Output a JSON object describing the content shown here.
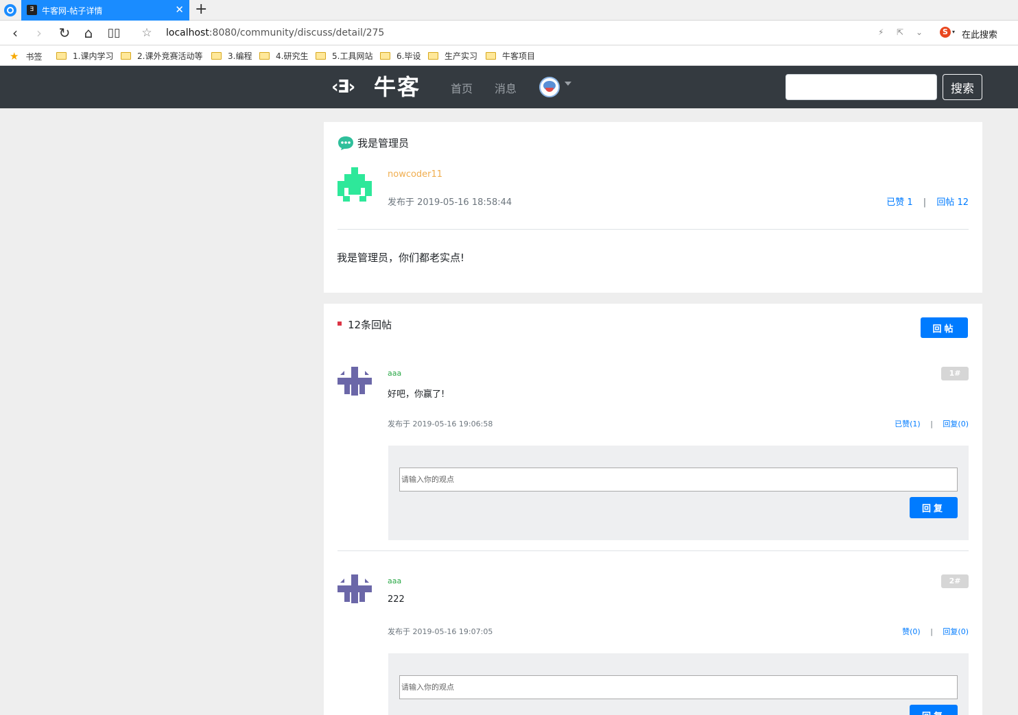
{
  "browser": {
    "tab_title": "牛客网-帖子详情",
    "tab_favicon": "Ǝ",
    "url_host": "localhost",
    "url_path": ":8080/community/discuss/detail/275",
    "search_label": "在此搜索",
    "search_engine_glyph": "S"
  },
  "bookmarks": [
    {
      "label": "书签",
      "icon": "star-icon"
    },
    {
      "label": "1.课内学习",
      "icon": "folder-icon"
    },
    {
      "label": "2.课外竞赛活动等",
      "icon": "folder-icon"
    },
    {
      "label": "3.编程",
      "icon": "folder-icon"
    },
    {
      "label": "4.研究生",
      "icon": "folder-icon"
    },
    {
      "label": "5.工具网站",
      "icon": "folder-icon"
    },
    {
      "label": "6.毕设",
      "icon": "folder-icon"
    },
    {
      "label": "生产实习",
      "icon": "folder-icon"
    },
    {
      "label": "牛客项目",
      "icon": "folder-icon"
    }
  ],
  "header": {
    "logo_mark": "‹Ǝ›",
    "logo_text": "牛客",
    "nav_home": "首页",
    "nav_messages": "消息",
    "search_button": "搜索",
    "search_value": ""
  },
  "post": {
    "title": "我是管理员",
    "author": "nowcoder11",
    "time": "发布于 2019-05-16 18:58:44",
    "like_label": "已赞 1",
    "reply_label": "回帖 12",
    "separator": "|",
    "content": "我是管理员，你们都老实点!"
  },
  "comments_section": {
    "count_label": "12条回帖",
    "reply_post_button": "回帖",
    "comments": [
      {
        "user": "aaa",
        "floor": "1#",
        "text": "好吧，你赢了!",
        "time": "发布于 2019-05-16 19:06:58",
        "like_label": "已赞(1)",
        "reply_label": "回复(0)",
        "separator": "|",
        "input_placeholder": "请输入你的观点",
        "reply_button": "回复"
      },
      {
        "user": "aaa",
        "floor": "2#",
        "text": "222",
        "time": "发布于 2019-05-16 19:07:05",
        "like_label": "赞(0)",
        "reply_label": "回复(0)",
        "separator": "|",
        "input_placeholder": "请输入你的观点",
        "reply_button": "回复"
      }
    ]
  },
  "colors": {
    "header_bg": "#343a40",
    "primary": "#007bff",
    "author_name": "#f0ad4e",
    "comment_user": "#28a745",
    "tab_active": "#1a8cff"
  }
}
